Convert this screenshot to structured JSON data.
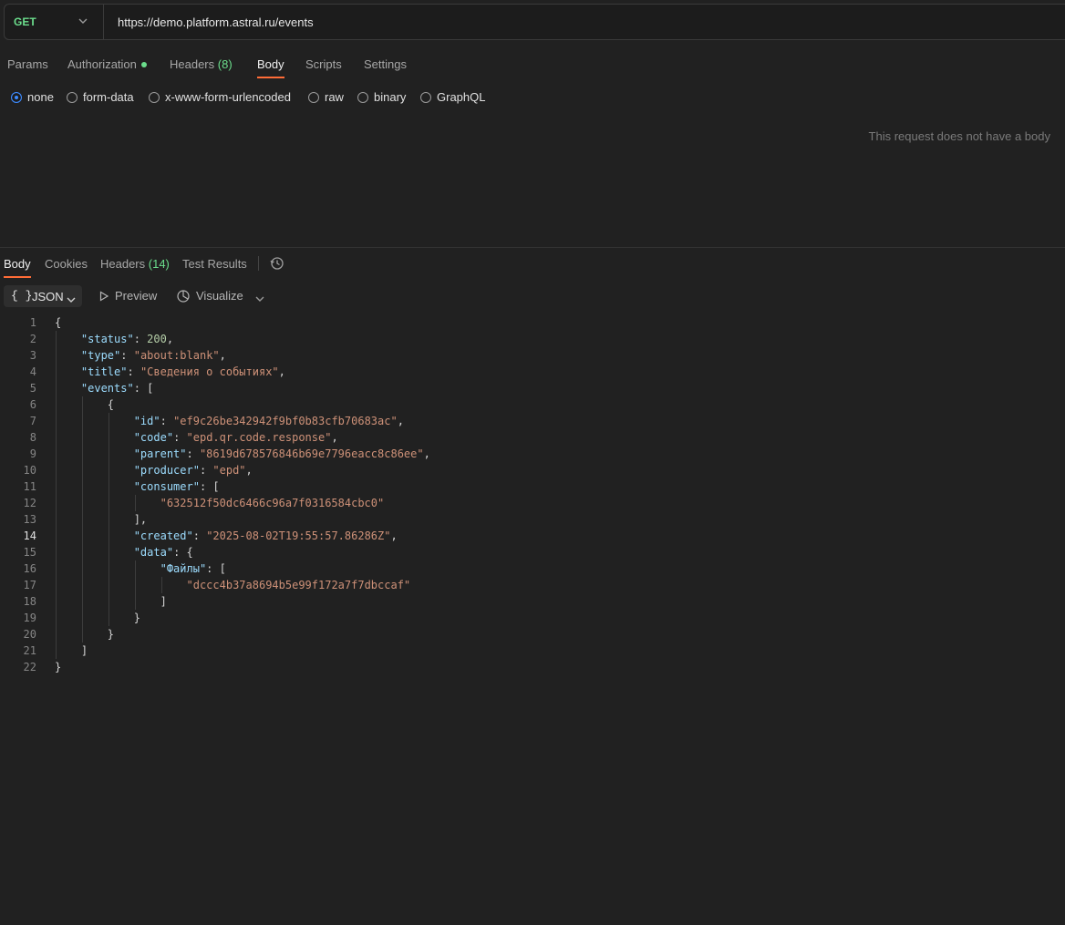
{
  "request": {
    "method": "GET",
    "url": "https://demo.platform.astral.ru/events",
    "tabs": [
      {
        "label": "Params"
      },
      {
        "label": "Authorization"
      },
      {
        "label": "Headers",
        "count": "(8)"
      },
      {
        "label": "Body"
      },
      {
        "label": "Scripts"
      },
      {
        "label": "Settings"
      }
    ],
    "active_tab": "Body",
    "body_types": [
      "none",
      "form-data",
      "x-www-form-urlencoded",
      "raw",
      "binary",
      "GraphQL"
    ],
    "selected_body_type": "none",
    "empty_message": "This request does not have a body"
  },
  "response": {
    "tabs": [
      {
        "label": "Body"
      },
      {
        "label": "Cookies"
      },
      {
        "label": "Headers",
        "count": "(14)"
      },
      {
        "label": "Test Results"
      }
    ],
    "active_tab": "Body",
    "format": "JSON",
    "format_braces": "{ }",
    "toolbar": {
      "preview": "Preview",
      "visualize": "Visualize"
    },
    "line_numbers": [
      "1",
      "2",
      "3",
      "4",
      "5",
      "6",
      "7",
      "8",
      "9",
      "10",
      "11",
      "12",
      "13",
      "14",
      "15",
      "16",
      "17",
      "18",
      "19",
      "20",
      "21",
      "22"
    ],
    "code": {
      "status_key": "\"status\"",
      "status_val": "200",
      "type_key": "\"type\"",
      "type_val": "\"about:blank\"",
      "title_key": "\"title\"",
      "title_val": "\"Сведения о событиях\"",
      "events_key": "\"events\"",
      "id_key": "\"id\"",
      "id_val": "\"ef9c26be342942f9bf0b83cfb70683ac\"",
      "code_key": "\"code\"",
      "code_val": "\"epd.qr.code.response\"",
      "parent_key": "\"parent\"",
      "parent_val": "\"8619d678576846b69e7796eacc8c86ee\"",
      "producer_key": "\"producer\"",
      "producer_val": "\"epd\"",
      "consumer_key": "\"consumer\"",
      "consumer_item": "\"632512f50dc6466c96a7f0316584cbc0\"",
      "created_key": "\"created\"",
      "created_val": "\"2025-08-02T19:55:57.86286Z\"",
      "data_key": "\"data\"",
      "files_key": "\"Файлы\"",
      "files_item": "\"dccc4b37a8694b5e99f172a7f7dbccaf\""
    }
  },
  "colors": {
    "accent": "#ff6c37",
    "method": "#6bdd8c",
    "radio_selected": "#3d8bff"
  }
}
